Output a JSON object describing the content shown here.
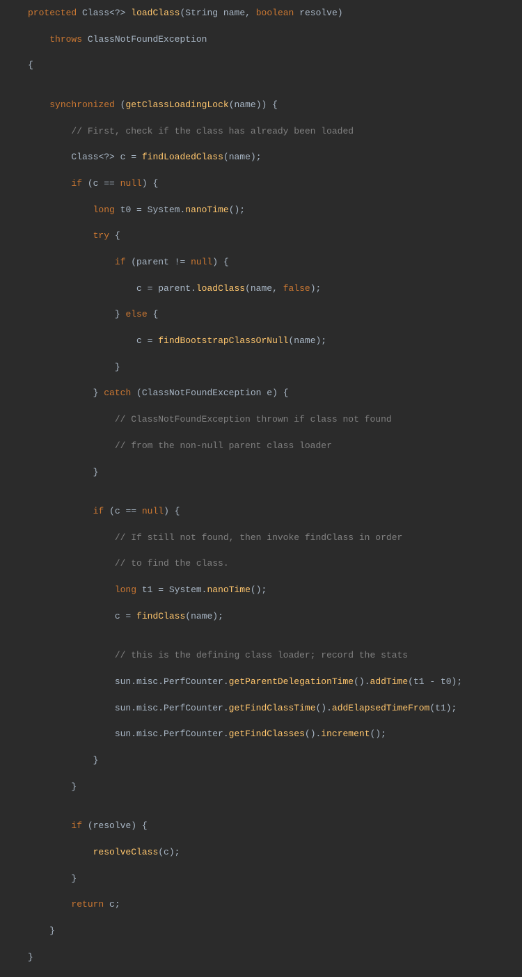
{
  "code": {
    "l1_kw1": "protected",
    "l1_type1": "Class",
    "l1_generic": "<?>",
    "l1_method": "loadClass",
    "l1_paren_o": "(",
    "l1_ptype1": "String",
    "l1_pname1": "name",
    "l1_comma": ", ",
    "l1_ptype2": "boolean",
    "l1_pname2": "resolve",
    "l1_paren_c": ")",
    "l2_kw": "throws",
    "l2_exc": "ClassNotFoundException",
    "l3_brace": "{",
    "l5_kw": "synchronized",
    "l5_paren_o": " (",
    "l5_method": "getClassLoadingLock",
    "l5_arg_o": "(",
    "l5_arg": "name",
    "l5_arg_c": ")) {",
    "l6_comment": "// First, check if the class has already been loaded",
    "l7_type": "Class",
    "l7_generic": "<?>",
    "l7_var": " c = ",
    "l7_method": "findLoadedClass",
    "l7_args": "(name);",
    "l8_kw": "if",
    "l8_cond_o": " (c == ",
    "l8_null": "null",
    "l8_cond_c": ") {",
    "l9_kw": "long",
    "l9_var": " t0 = ",
    "l9_cls": "System",
    "l9_dot": ".",
    "l9_method": "nanoTime",
    "l9_end": "();",
    "l10_kw": "try",
    "l10_brace": " {",
    "l11_kw": "if",
    "l11_cond_o": " (parent != ",
    "l11_null": "null",
    "l11_cond_c": ") {",
    "l12_assign": "c = parent.",
    "l12_method": "loadClass",
    "l12_args_o": "(name, ",
    "l12_false": "false",
    "l12_args_c": ");",
    "l13_brace_c": "} ",
    "l13_kw": "else",
    "l13_brace_o": " {",
    "l14_assign": "c = ",
    "l14_method": "findBootstrapClassOrNull",
    "l14_args": "(name);",
    "l15_brace": "}",
    "l16_brace_c": "} ",
    "l16_kw": "catch",
    "l16_paren_o": " (",
    "l16_type": "ClassNotFoundException",
    "l16_var": " e",
    "l16_paren_c": ") {",
    "l17_comment": "// ClassNotFoundException thrown if class not found",
    "l18_comment": "// from the non-null parent class loader",
    "l19_brace": "}",
    "l21_kw": "if",
    "l21_cond_o": " (c == ",
    "l21_null": "null",
    "l21_cond_c": ") {",
    "l22_comment": "// If still not found, then invoke findClass in order",
    "l23_comment": "// to find the class.",
    "l24_kw": "long",
    "l24_var": " t1 = ",
    "l24_cls": "System",
    "l24_dot": ".",
    "l24_method": "nanoTime",
    "l24_end": "();",
    "l25_assign": "c = ",
    "l25_method": "findClass",
    "l25_args": "(name);",
    "l27_comment": "// this is the defining class loader; record the stats",
    "l28_pkg": "sun.misc.PerfCounter",
    "l28_dot1": ".",
    "l28_method1": "getParentDelegationTime",
    "l28_paren1": "().",
    "l28_method2": "addTime",
    "l28_args": "(t1 - t0);",
    "l29_pkg": "sun.misc.PerfCounter",
    "l29_dot1": ".",
    "l29_method1": "getFindClassTime",
    "l29_paren1": "().",
    "l29_method2": "addElapsedTimeFrom",
    "l29_args": "(t1);",
    "l30_pkg": "sun.misc.PerfCounter",
    "l30_dot1": ".",
    "l30_method1": "getFindClasses",
    "l30_paren1": "().",
    "l30_method2": "increment",
    "l30_args": "();",
    "l31_brace": "}",
    "l32_brace": "}",
    "l34_kw": "if",
    "l34_cond": " (resolve) {",
    "l35_method": "resolveClass",
    "l35_args": "(c);",
    "l36_brace": "}",
    "l37_kw": "return",
    "l37_var": " c;",
    "l38_brace": "}",
    "l39_brace": "}"
  }
}
